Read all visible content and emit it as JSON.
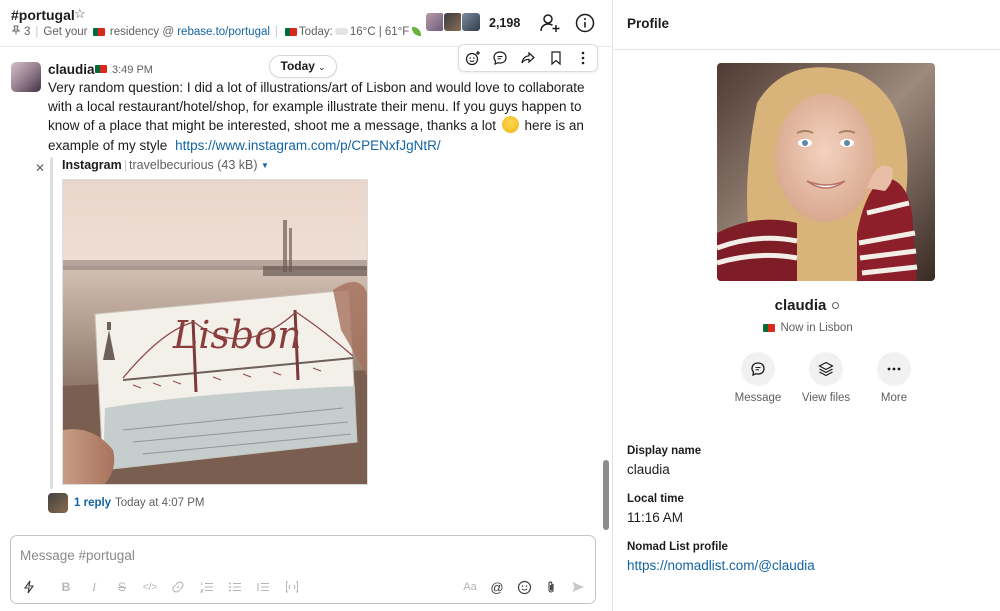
{
  "channel": {
    "name": "#portugal",
    "pinned_count": "3",
    "topic": {
      "prefix": "Get your",
      "middle": "residency @",
      "link": "rebase.to/portugal",
      "weather_prefix": "Today:",
      "weather": "16°C | 61°F"
    },
    "member_count": "2,198"
  },
  "date_divider": {
    "label": "Today"
  },
  "message": {
    "author": "claudia",
    "time": "3:49 PM",
    "text_main": "Very random question: I did a lot of illustrations/art of Lisbon and would love to collaborate with a local restaurant/hotel/shop, for example illustrate their menu. If you guys happen to know of a place that might be interested, shoot me a message, thanks a lot",
    "text_after_emoji": "here is an example of my style",
    "link": "https://www.instagram.com/p/CPENxfJgNtR/",
    "attachment": {
      "source": "Instagram",
      "name": "travelbecurious (43 kB)",
      "image_caption": "Lisbon"
    },
    "thread": {
      "reply_count": "1 reply",
      "last_reply": "Today at 4:07 PM"
    }
  },
  "composer": {
    "placeholder": "Message #portugal"
  },
  "profile": {
    "title": "Profile",
    "name": "claudia",
    "status": "Now in Lisbon",
    "actions": [
      {
        "label": "Message",
        "icon": "message-icon"
      },
      {
        "label": "View files",
        "icon": "files-icon"
      },
      {
        "label": "More",
        "icon": "more-icon"
      }
    ],
    "fields": [
      {
        "label": "Display name",
        "value": "claudia"
      },
      {
        "label": "Local time",
        "value": "11:16 AM"
      },
      {
        "label": "Nomad List profile",
        "value": "https://nomadlist.com/@claudia"
      }
    ]
  },
  "colors": {
    "link": "#1264a3",
    "text": "#1d1c1d",
    "muted": "#616061",
    "flag_green": "#046a38",
    "flag_red": "#da291c"
  }
}
